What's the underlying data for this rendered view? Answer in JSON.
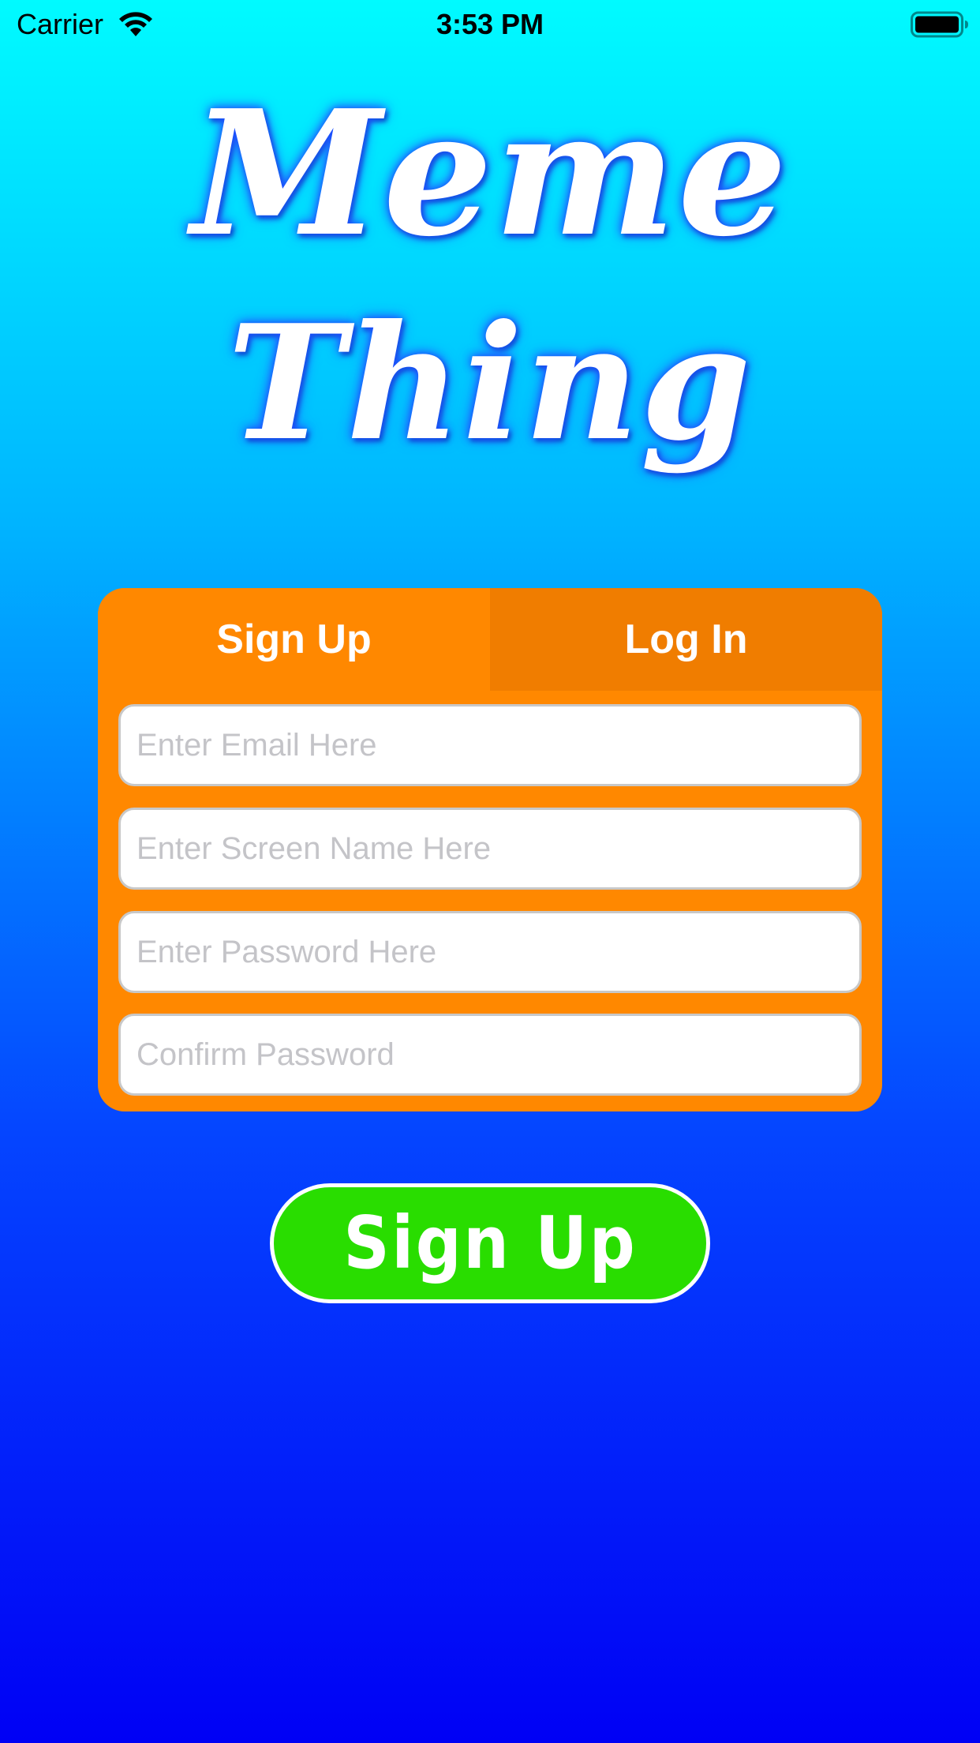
{
  "status_bar": {
    "carrier": "Carrier",
    "time": "3:53 PM",
    "wifi_icon": "wifi-icon",
    "battery_icon": "battery-icon"
  },
  "app": {
    "title_line_1": "Meme",
    "title_line_2": "Thing"
  },
  "tabs": [
    {
      "label": "Sign Up",
      "selected": true
    },
    {
      "label": "Log In",
      "selected": false
    }
  ],
  "form": {
    "email_placeholder": "Enter Email Here",
    "email_value": "",
    "screen_name_placeholder": "Enter Screen Name Here",
    "screen_name_value": "",
    "password_placeholder": "Enter Password Here",
    "password_value": "",
    "confirm_placeholder": "Confirm Password",
    "confirm_value": ""
  },
  "actions": {
    "submit_label": "Sign Up"
  },
  "colors": {
    "background_top": "#00fbff",
    "background_bottom": "#0000f5",
    "card": "#ff8800",
    "inactive_tab": "#f07d00",
    "button": "#29dd00",
    "title_text": "#ffffff"
  }
}
